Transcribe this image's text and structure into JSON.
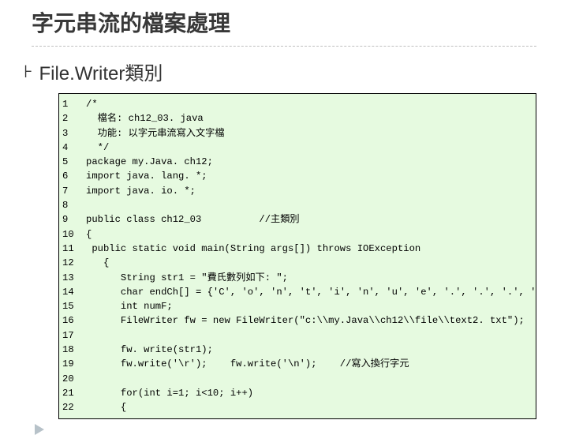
{
  "title": "字元串流的檔案處理",
  "subtitle_bullet": "⊦",
  "subtitle": "File.Writer類別",
  "code": {
    "line_numbers": [
      "1",
      "2",
      "3",
      "4",
      "5",
      "6",
      "7",
      "8",
      "9",
      "10",
      "11",
      "12",
      "13",
      "14",
      "15",
      "16",
      "17",
      "18",
      "19",
      "20",
      "21",
      "22"
    ],
    "lines": [
      "/*",
      "  檔名: ch12_03. java",
      "  功能: 以字元串流寫入文字檔",
      "  */",
      "package my.Java. ch12;",
      "import java. lang. *;",
      "import java. io. *;",
      "",
      "public class ch12_03          //主類別",
      "{",
      " public static void main(String args[]) throws IOException",
      "   {",
      "      String str1 = \"費氏數列如下: \";",
      "      char endCh[] = {'C', 'o', 'n', 't', 'i', 'n', 'u', 'e', '.', '.', '.', '.', '.'};",
      "      int numF;",
      "      FileWriter fw = new FileWriter(\"c:\\\\my.Java\\\\ch12\\\\file\\\\text2. txt\");",
      "",
      "      fw. write(str1);",
      "      fw.write('\\r');    fw.write('\\n');    //寫入換行字元",
      "",
      "      for(int i=1; i<10; i++)",
      "      {"
    ]
  }
}
